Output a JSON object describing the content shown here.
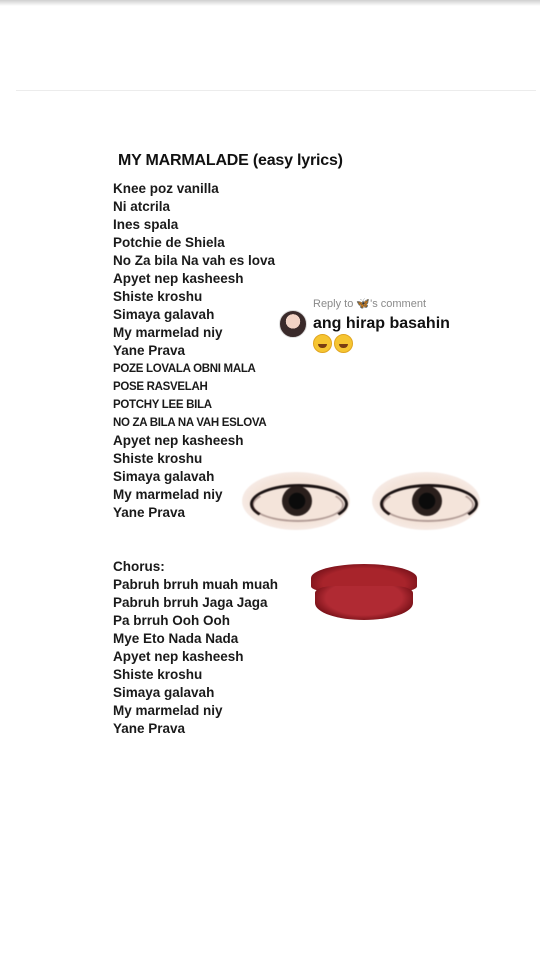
{
  "lyrics": {
    "title": "MY MARMALADE (easy lyrics)",
    "lines": [
      {
        "text": "Knee poz vanilla",
        "style": "normal"
      },
      {
        "text": "Ni atcrila",
        "style": "normal"
      },
      {
        "text": "Ines spala",
        "style": "normal"
      },
      {
        "text": "Potchie de Shiela",
        "style": "normal"
      },
      {
        "text": "No Za bila Na vah es lova",
        "style": "normal"
      },
      {
        "text": "Apyet nep kasheesh",
        "style": "normal"
      },
      {
        "text": "Shiste kroshu",
        "style": "normal"
      },
      {
        "text": "Simaya galavah",
        "style": "normal"
      },
      {
        "text": "My marmelad niy",
        "style": "normal"
      },
      {
        "text": "Yane Prava",
        "style": "normal"
      },
      {
        "text": "POZE LOVALA OBNI MALA",
        "style": "small"
      },
      {
        "text": "POSE RASVELAH",
        "style": "small"
      },
      {
        "text": "POTCHY LEE BILA",
        "style": "small"
      },
      {
        "text": "NO ZA BILA NA VAH ESLOVA",
        "style": "small"
      },
      {
        "text": "Apyet nep kasheesh",
        "style": "normal"
      },
      {
        "text": "Shiste kroshu",
        "style": "normal"
      },
      {
        "text": "Simaya galavah",
        "style": "normal"
      },
      {
        "text": "My marmelad niy",
        "style": "normal"
      },
      {
        "text": "Yane Prava",
        "style": "normal"
      },
      {
        "text": "",
        "style": "blank"
      },
      {
        "text": "",
        "style": "blank"
      },
      {
        "text": "Chorus:",
        "style": "normal"
      },
      {
        "text": "Pabruh brruh muah muah",
        "style": "normal"
      },
      {
        "text": "Pabruh brruh Jaga Jaga",
        "style": "normal"
      },
      {
        "text": "Pa brruh Ooh Ooh",
        "style": "normal"
      },
      {
        "text": "Mye Eto Nada Nada",
        "style": "normal"
      },
      {
        "text": "Apyet nep kasheesh",
        "style": "normal"
      },
      {
        "text": "Shiste kroshu",
        "style": "normal"
      },
      {
        "text": "Simaya galavah",
        "style": "normal"
      },
      {
        "text": "My marmelad niy",
        "style": "normal"
      },
      {
        "text": "Yane Prava",
        "style": "normal"
      }
    ]
  },
  "reply": {
    "prefix": "Reply to",
    "icon": "butterfly-icon",
    "suffix": "'s comment",
    "comment": "ang hirap basahin",
    "emojis": [
      "rofl-emoji",
      "rofl-emoji"
    ]
  },
  "colors": {
    "text": "#111111",
    "meta": "#8a8a8a",
    "lips": "#a8242b"
  }
}
